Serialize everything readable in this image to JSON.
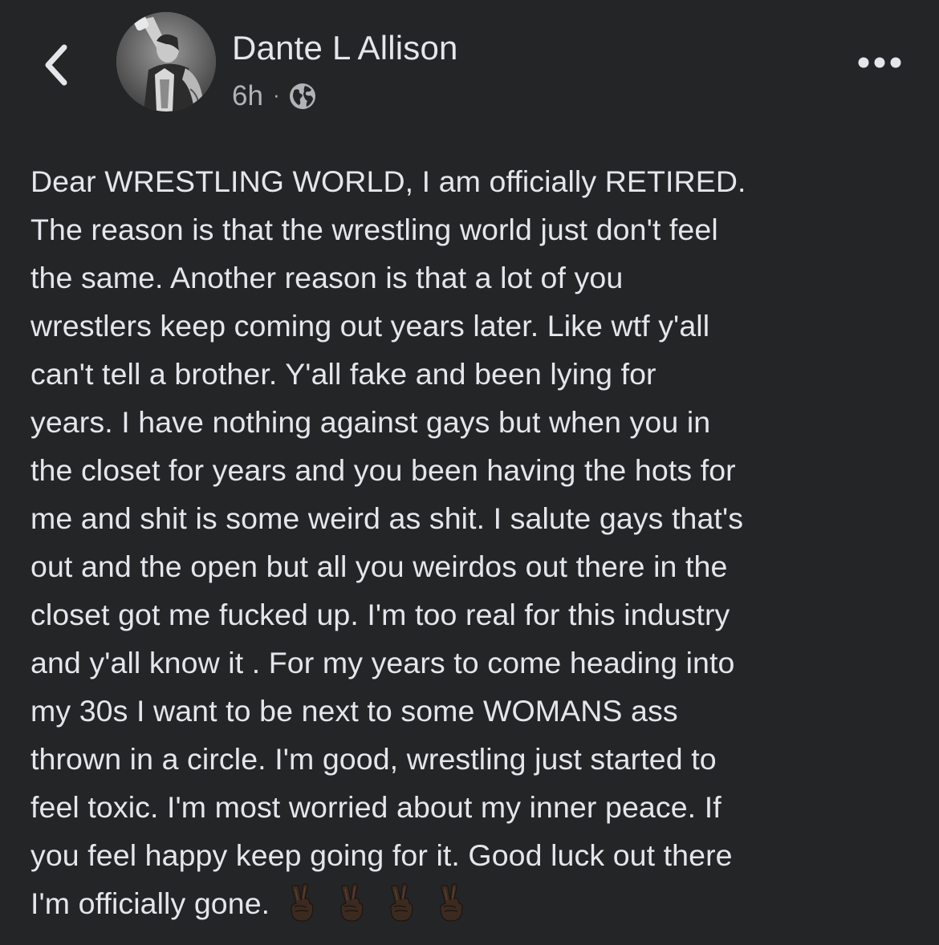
{
  "header": {
    "back_icon": "chevron-left-icon",
    "author_name": "Dante L Allison",
    "time": "6h",
    "separator": "·",
    "privacy_icon": "globe-icon",
    "more_icon": "more-horizontal-icon"
  },
  "post": {
    "lines": [
      "Dear WRESTLING WORLD, I am officially RETIRED.",
      "The reason is that the wrestling world just don't feel",
      "the same. Another reason is that a lot of you",
      "wrestlers keep coming out years later. Like wtf y'all",
      "can't tell a brother. Y'all fake and been lying for",
      "years. I have nothing against gays but when you in",
      "the closet for years and you been having the hots for",
      "me and shit is some weird as shit. I salute gays that's",
      "out and the open but all you weirdos out there in the",
      "closet got me fucked up. I'm too real for this industry",
      "and y'all know it . For my years to come heading into",
      "my 30s I want to be next to some WOMANS ass",
      "thrown in a circle. I'm good, wrestling just started to",
      "feel toxic. I'm most worried about my inner peace. If",
      "you feel happy keep going for it. Good luck out there",
      "I'm officially gone."
    ],
    "emoji": [
      "victory-hand-dark-skin-icon",
      "victory-hand-dark-skin-icon",
      "victory-hand-dark-skin-icon",
      "victory-hand-dark-skin-icon"
    ]
  },
  "colors": {
    "background": "#242526",
    "primary_text": "#e4e6eb",
    "secondary_text": "#b0b3b8"
  }
}
